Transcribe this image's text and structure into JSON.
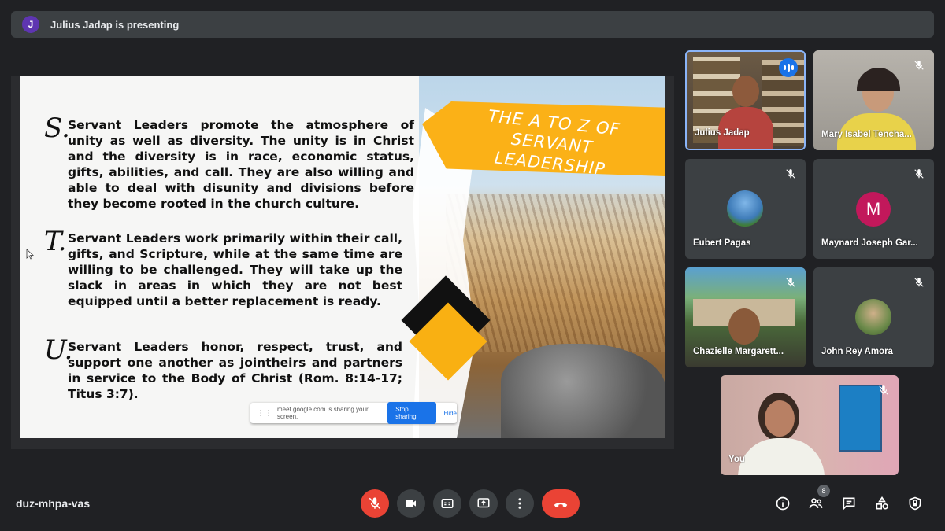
{
  "presenting": {
    "avatar_letter": "J",
    "text": "Julius Jadap is presenting"
  },
  "slide": {
    "banner": "THE A TO Z OF SERVANT LEADERSHIP",
    "items": [
      {
        "letter": "S.",
        "text": "Servant Leaders promote the atmosphere of unity as well as diversity. The unity is in Christ and the diversity is in race, economic status, gifts, abilities, and call. They are also willing and able to deal with disunity and divisions before they become rooted in the church culture."
      },
      {
        "letter": "T.",
        "text": "Servant Leaders work primarily within their call, gifts, and Scripture, while at the same time are willing to be challenged. They will take up the slack in areas in which they are not best equipped until a better replacement is ready."
      },
      {
        "letter": "U.",
        "text": "Servant Leaders honor, respect, trust, and support one another as jointheirs and partners in service to the Body of Christ (Rom. 8:14-17; Titus 3:7)."
      }
    ],
    "share_notice": {
      "text": "meet.google.com is sharing your screen.",
      "stop_label": "Stop sharing",
      "hide_label": "Hide"
    }
  },
  "participants": [
    {
      "name": "Julius Jadap",
      "state": "speaking"
    },
    {
      "name": "Mary Isabel Tencha...",
      "state": "muted"
    },
    {
      "name": "Eubert Pagas",
      "state": "muted"
    },
    {
      "name": "Maynard Joseph Gar...",
      "state": "muted",
      "avatar_letter": "M"
    },
    {
      "name": "Chazielle Margarett...",
      "state": "muted"
    },
    {
      "name": "John Rey Amora",
      "state": "muted"
    },
    {
      "name": "You",
      "state": "muted"
    }
  ],
  "toolbar": {
    "meeting_code": "duz-mhpa-vas",
    "people_count": "8",
    "controls": [
      "mic-off",
      "camera",
      "captions",
      "present",
      "more",
      "leave-call"
    ],
    "right": [
      "info",
      "people",
      "chat",
      "activities",
      "host-controls"
    ]
  },
  "colors": {
    "background": "#202124",
    "tile": "#3c4043",
    "danger": "#ea4335",
    "accent": "#1a73e8",
    "banner": "#fbb117"
  }
}
